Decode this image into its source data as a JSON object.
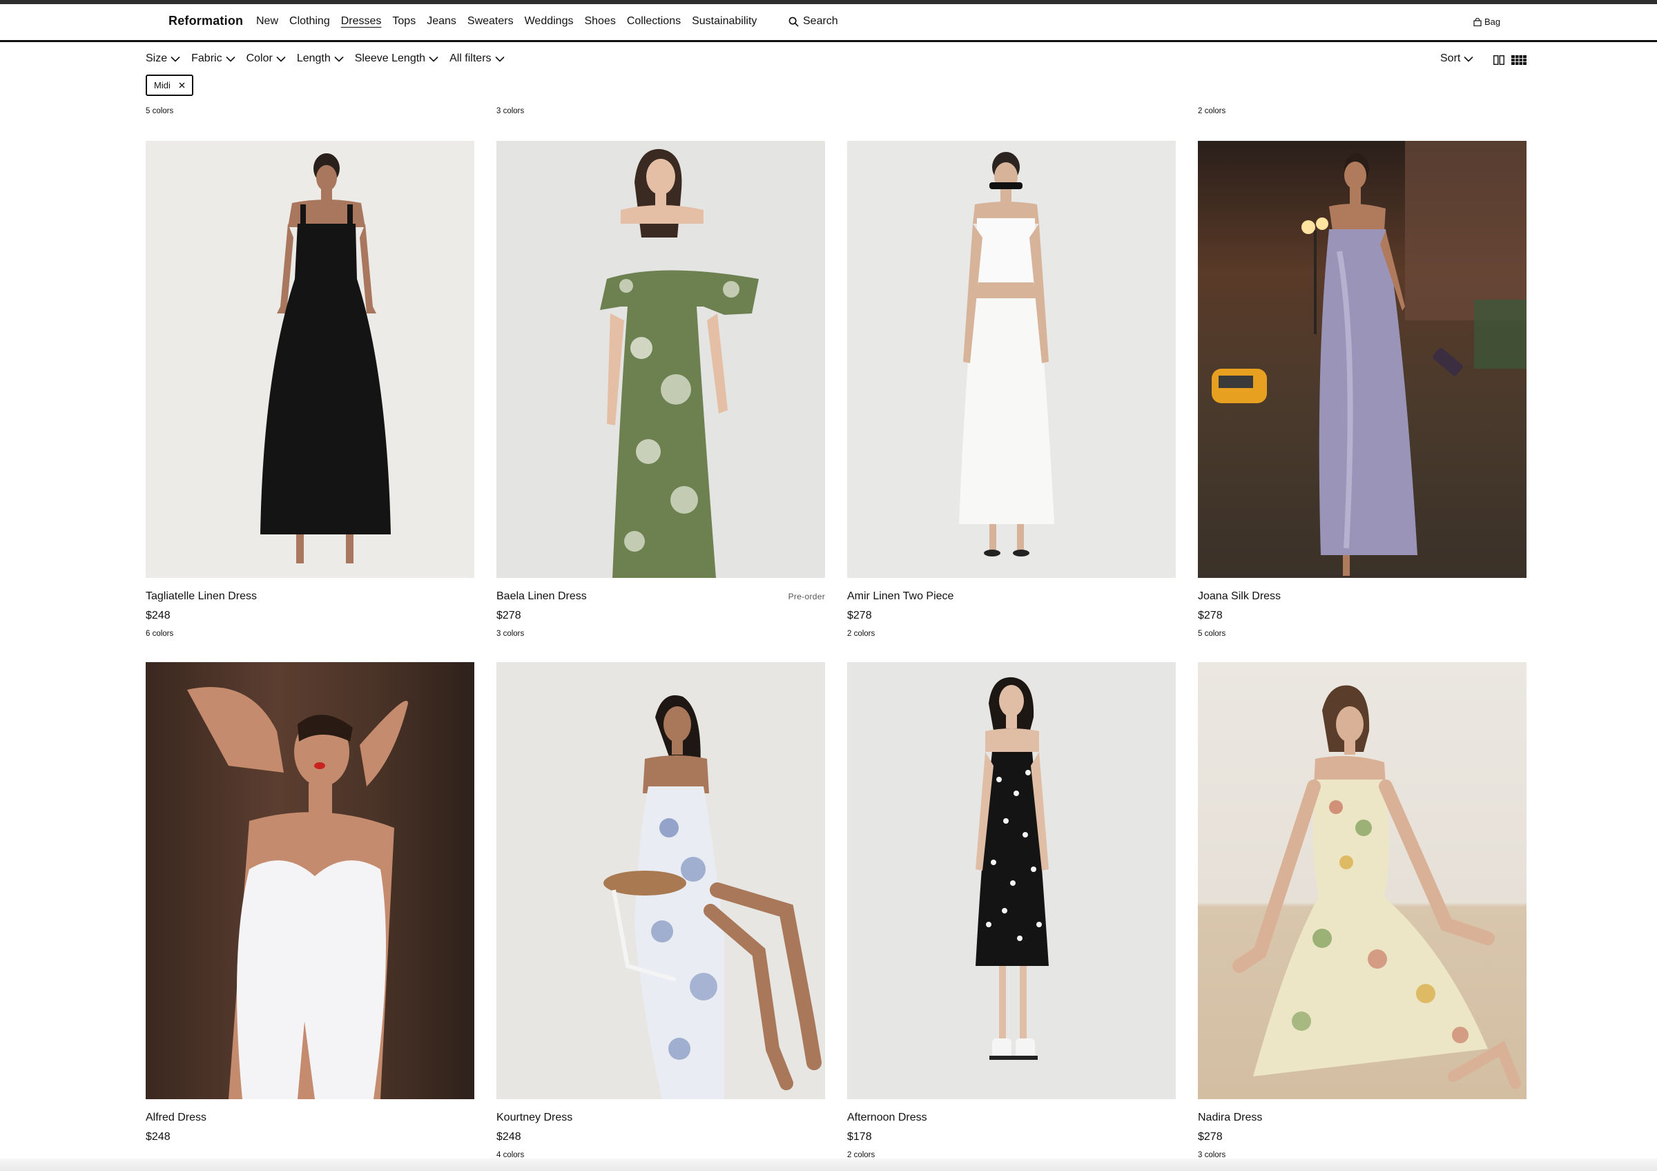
{
  "brand": "Reformation",
  "nav": {
    "items": [
      "New",
      "Clothing",
      "Dresses",
      "Tops",
      "Jeans",
      "Sweaters",
      "Weddings",
      "Shoes",
      "Collections",
      "Sustainability"
    ],
    "active": "Dresses",
    "search_label": "Search",
    "bag_label": "Bag"
  },
  "filters": {
    "size": "Size",
    "fabric": "Fabric",
    "color": "Color",
    "length": "Length",
    "sleeve_length": "Sleeve Length",
    "all_filters": "All filters",
    "sort": "Sort"
  },
  "active_chip": "Midi",
  "previous_row_colors": [
    "5 colors",
    "3 colors",
    "2 colors"
  ],
  "products": [
    {
      "name": "Tagliatelle Linen Dress",
      "price": "$248",
      "colors": "6 colors",
      "badge": ""
    },
    {
      "name": "Baela Linen Dress",
      "price": "$278",
      "colors": "3 colors",
      "badge": "Pre-order"
    },
    {
      "name": "Amir Linen Two Piece",
      "price": "$278",
      "colors": "2 colors",
      "badge": ""
    },
    {
      "name": "Joana Silk Dress",
      "price": "$278",
      "colors": "5 colors",
      "badge": ""
    },
    {
      "name": "Alfred Dress",
      "price": "$248",
      "colors": "",
      "badge": ""
    },
    {
      "name": "Kourtney Dress",
      "price": "$248",
      "colors": "4 colors",
      "badge": ""
    },
    {
      "name": "Afternoon Dress",
      "price": "$178",
      "colors": "2 colors",
      "badge": ""
    },
    {
      "name": "Nadira Dress",
      "price": "$278",
      "colors": "3 colors",
      "badge": ""
    }
  ]
}
